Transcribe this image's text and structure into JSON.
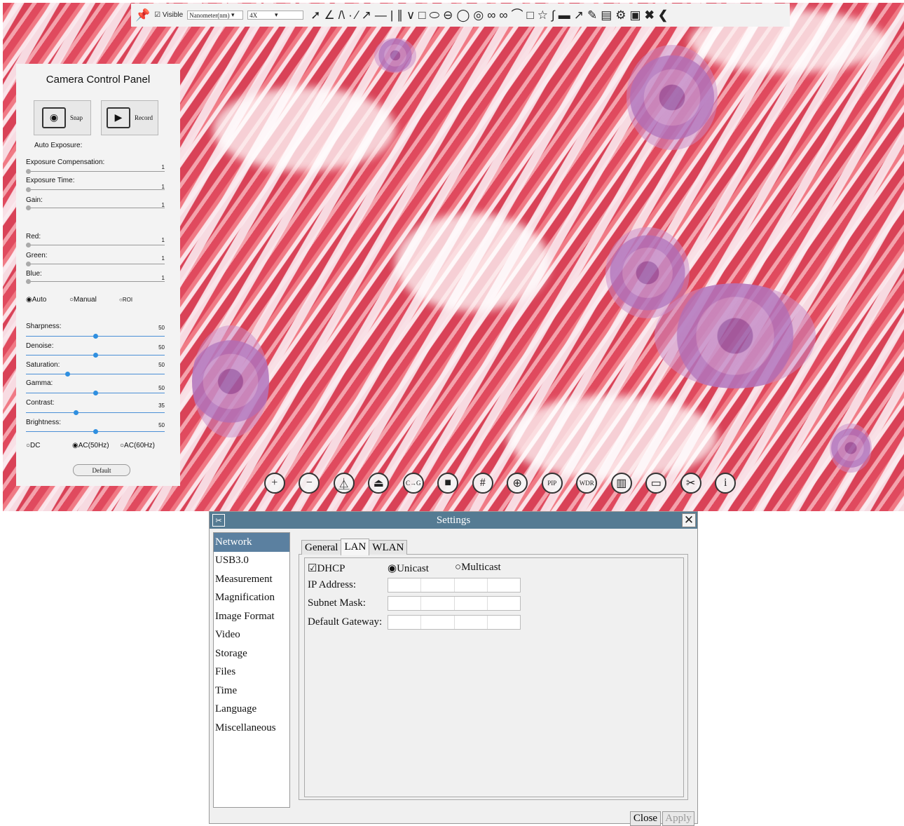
{
  "toolbar": {
    "visible_label": "Visible",
    "unit_select": "Nanometer(nm)",
    "magnification_select": "4X",
    "tools": [
      "pin-icon",
      "cursor-icon",
      "angle-icon",
      "polyline-icon",
      "point-icon",
      "line-icon",
      "arrow-line-icon",
      "hline-icon",
      "vline-icon",
      "parallel-icon",
      "cross-icon",
      "rectangle-icon",
      "ellipse-icon",
      "circle-3pt-icon",
      "circle-icon",
      "annulus-icon",
      "two-circles-icon",
      "link-circles-icon",
      "arc-icon",
      "text-icon",
      "polygon-icon",
      "curve-icon",
      "scale-bar-icon",
      "arrow-icon",
      "eraser-icon",
      "export-icon",
      "settings-icon",
      "layers-icon",
      "close-icon",
      "collapse-icon"
    ]
  },
  "camera_panel": {
    "title": "Camera Control Panel",
    "snap_label": "Snap",
    "record_label": "Record",
    "auto_exposure_label": "Auto Exposure:",
    "exposure_compensation": {
      "label": "Exposure Compensation:",
      "value": "1",
      "level": 0.02
    },
    "exposure_time": {
      "label": "Exposure Time:",
      "value": "1",
      "level": 0.02
    },
    "gain": {
      "label": "Gain:",
      "value": "1",
      "level": 0.02
    },
    "red": {
      "label": "Red:",
      "value": "1",
      "level": 0.02
    },
    "green": {
      "label": "Green:",
      "value": "1",
      "level": 0.02
    },
    "blue": {
      "label": "Blue:",
      "value": "1",
      "level": 0.02
    },
    "wb_modes": [
      "Auto",
      "Manual",
      "ROI"
    ],
    "wb_selected": "Auto",
    "sharpness": {
      "label": "Sharpness:",
      "value": "50",
      "level": 0.5
    },
    "denoise": {
      "label": "Denoise:",
      "value": "50",
      "level": 0.5
    },
    "saturation": {
      "label": "Saturation:",
      "value": "50",
      "level": 0.3
    },
    "gamma": {
      "label": "Gamma:",
      "value": "50",
      "level": 0.5
    },
    "contrast": {
      "label": "Contrast:",
      "value": "35",
      "level": 0.36
    },
    "brightness": {
      "label": "Brightness:",
      "value": "50",
      "level": 0.5
    },
    "power_modes": [
      "DC",
      "AC(50Hz)",
      "AC(60Hz)"
    ],
    "power_selected": "AC(50Hz)",
    "default_label": "Default"
  },
  "bottom_toolbar": {
    "buttons": [
      {
        "name": "zoom-in-icon",
        "glyph": "+"
      },
      {
        "name": "zoom-out-icon",
        "glyph": "−"
      },
      {
        "name": "flip-horizontal-icon",
        "glyph": "⏅"
      },
      {
        "name": "flip-vertical-icon",
        "glyph": "⏏"
      },
      {
        "name": "color-to-gray-icon",
        "glyph": "C→G"
      },
      {
        "name": "stop-icon",
        "glyph": "■"
      },
      {
        "name": "grid-icon",
        "glyph": "#"
      },
      {
        "name": "target-icon",
        "glyph": "⊕"
      },
      {
        "name": "pip-icon",
        "glyph": "PIP"
      },
      {
        "name": "wdr-icon",
        "glyph": "WDR"
      },
      {
        "name": "compare-icon",
        "glyph": "▥"
      },
      {
        "name": "browse-folder-icon",
        "glyph": "▭"
      },
      {
        "name": "settings-tools-icon",
        "glyph": "✂"
      },
      {
        "name": "info-icon",
        "glyph": "i"
      }
    ]
  },
  "settings": {
    "title": "Settings",
    "nav": [
      "Network",
      "USB3.0",
      "Measurement",
      "Magnification",
      "Image Format",
      "Video",
      "Storage",
      "Files",
      "Time",
      "Language",
      "Miscellaneous"
    ],
    "nav_selected": "Network",
    "tabs": [
      "General",
      "LAN",
      "WLAN"
    ],
    "active_tab": "LAN",
    "dhcp_label": "DHCP",
    "unicast_label": "Unicast",
    "multicast_label": "Multicast",
    "ip_label": "IP Address:",
    "subnet_label": "Subnet Mask:",
    "gateway_label": "Default Gateway:",
    "close_label": "Close",
    "apply_label": "Apply"
  }
}
